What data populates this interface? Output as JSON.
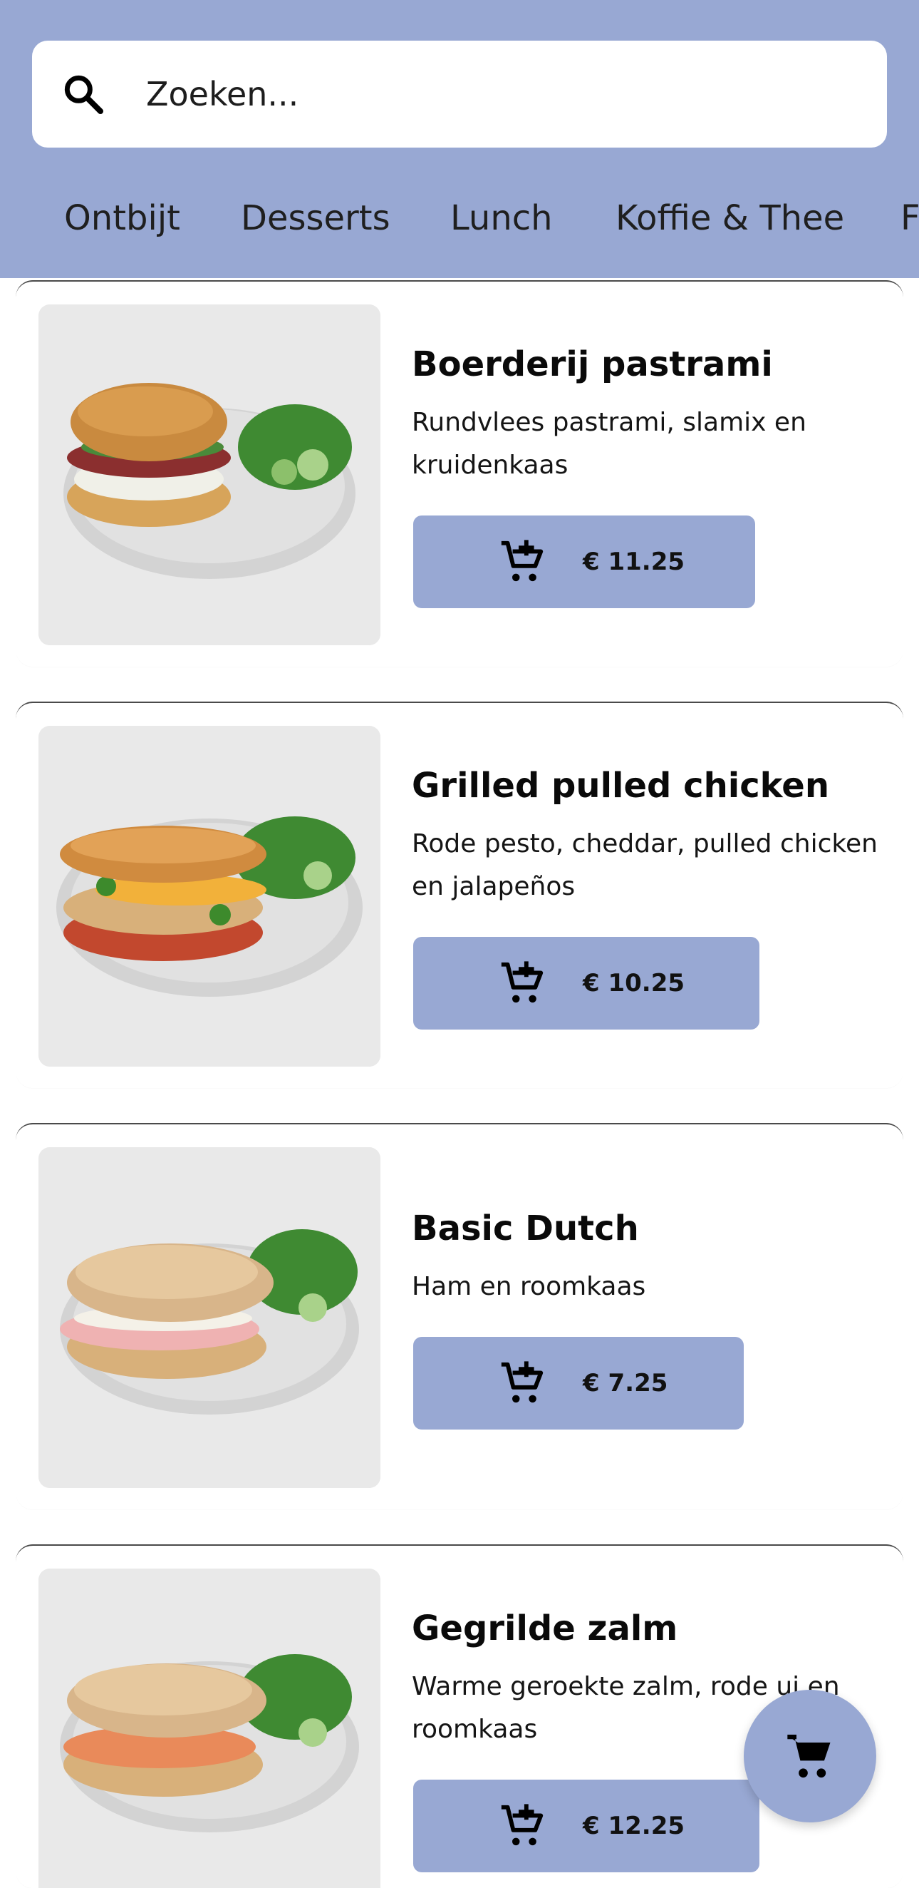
{
  "theme": {
    "accent": "#98a8d3",
    "background": "#ffffff"
  },
  "search": {
    "placeholder": "Zoeken...",
    "icon": "search-icon"
  },
  "tabs": [
    "Ontbijt",
    "Desserts",
    "Lunch",
    "Koffie & Thee",
    "F"
  ],
  "products": [
    {
      "name": "Boerderij pastrami",
      "description": "Rundvlees pastrami, slamix en kruidenkaas",
      "price": "€ 11.25"
    },
    {
      "name": "Grilled pulled chicken",
      "description": "Rode pesto, cheddar, pulled chicken en jalapeños",
      "price": "€ 10.25"
    },
    {
      "name": "Basic Dutch",
      "description": "Ham en roomkaas",
      "price": "€ 7.25"
    },
    {
      "name": "Gegrilde zalm",
      "description": "Warme geroekte zalm, rode ui en roomkaas",
      "price": "€ 12.25"
    }
  ],
  "cart": {
    "icon": "shopping-cart-icon"
  }
}
